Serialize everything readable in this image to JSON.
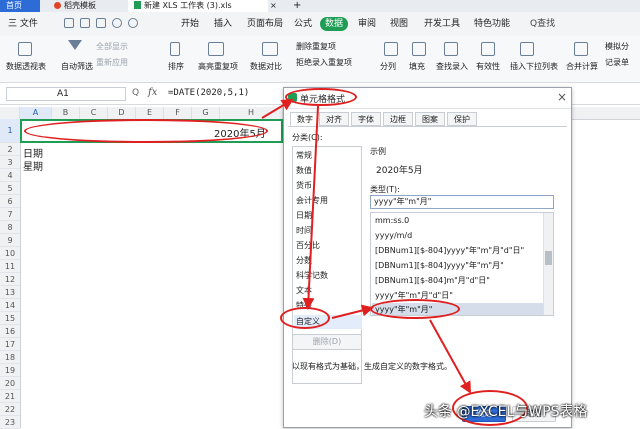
{
  "tabs": {
    "home": "首页",
    "template": "稻壳模板",
    "file": "新建 XLS 工作表 (3).xls",
    "close": "×",
    "add": "+"
  },
  "menu": {
    "file": "三 文件",
    "items": [
      "开始",
      "插入",
      "页面布局",
      "公式",
      "数据",
      "审阅",
      "视图",
      "开发工具",
      "特色功能"
    ],
    "active_index": 4,
    "search": "Q查找"
  },
  "ribbon": {
    "pivot": "数据透视表",
    "autofilter": "自动筛选",
    "show_all": "全部显示",
    "reapply": "重新应用",
    "sort": "排序",
    "highlight_dup": "高亮重复项",
    "compare": "数据对比",
    "remove_dup": "删除重复项",
    "reject_dup": "拒绝录入重复项",
    "split": "分列",
    "fill": "填充",
    "lookup": "查找录入",
    "validity": "有效性",
    "dropdown": "插入下拉列表",
    "merge": "合并计算",
    "simulate": "模拟分",
    "record": "记录单"
  },
  "formula_bar": {
    "cell_ref": "A1",
    "zoom_icon": "Q",
    "fx": "fx",
    "formula": "=DATE(2020,5,1)"
  },
  "sheet": {
    "columns": [
      "A",
      "B",
      "C",
      "D",
      "E",
      "F",
      "G",
      "H"
    ],
    "rows": [
      "1",
      "2",
      "3",
      "4",
      "5",
      "6",
      "7",
      "8",
      "9",
      "10",
      "11",
      "12",
      "13",
      "14",
      "15",
      "16",
      "17",
      "18",
      "19",
      "20",
      "21",
      "22",
      "23"
    ],
    "a1_value": "2020年5月",
    "a2_value": "日期",
    "a3_value": "星期"
  },
  "dialog": {
    "title": "单元格格式",
    "close": "×",
    "tabs": [
      "数字",
      "对齐",
      "字体",
      "边框",
      "图案",
      "保护"
    ],
    "category_label": "分类(C):",
    "categories": [
      "常规",
      "数值",
      "货币",
      "会计专用",
      "日期",
      "时间",
      "百分比",
      "分数",
      "科学记数",
      "文本",
      "特殊",
      "自定义"
    ],
    "selected_category": "自定义",
    "sample_label": "示例",
    "sample_value": "2020年5月",
    "type_label": "类型(T):",
    "type_value": "yyyy\"年\"m\"月\"",
    "type_options": [
      "mm:ss.0",
      "yyyy/m/d",
      "[DBNum1][$-804]yyyy\"年\"m\"月\"d\"日\"",
      "[DBNum1][$-804]yyyy\"年\"m\"月\"",
      "[DBNum1][$-804]m\"月\"d\"日\"",
      "yyyy\"年\"m\"月\"d\"日\"",
      "yyyy\"年\"m\"月\""
    ],
    "delete_button": "删除(D)",
    "hint": "以现有格式为基础，生成自定义的数字格式。",
    "ok_button": "确定",
    "cancel_button": "取消"
  },
  "watermark": "头条 @EXCEL与WPS表格",
  "colors": {
    "accent_green": "#1f9d55",
    "annotation_red": "#e02020",
    "tab_blue": "#2d6bd6"
  }
}
